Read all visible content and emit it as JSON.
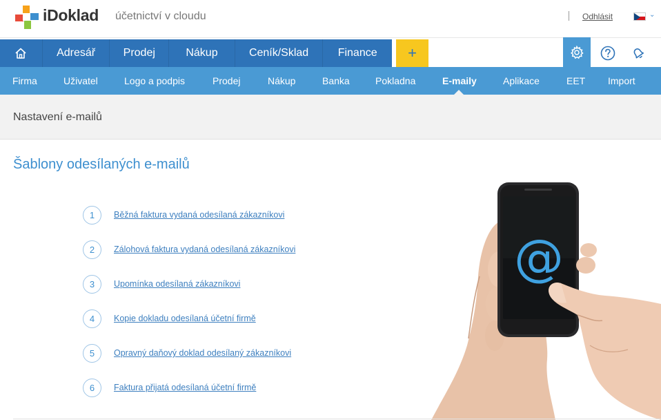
{
  "header": {
    "brand": "iDoklad",
    "tagline": "účetnictví v cloudu",
    "logout": "Odhlásit",
    "language_caret": "⌄"
  },
  "main_nav": {
    "items": [
      "Adresář",
      "Prodej",
      "Nákup",
      "Ceník/Sklad",
      "Finance"
    ],
    "plus": "+"
  },
  "sub_nav": {
    "items": [
      "Firma",
      "Uživatel",
      "Logo a podpis",
      "Prodej",
      "Nákup",
      "Banka",
      "Pokladna",
      "E-maily",
      "Aplikace",
      "EET",
      "Import"
    ],
    "active": "E-maily"
  },
  "page": {
    "title": "Nastavení e-mailů",
    "section_title": "Šablony odesílaných e-mailů"
  },
  "templates": [
    {
      "num": "1",
      "label": "Běžná faktura vydaná odesílaná zákazníkovi"
    },
    {
      "num": "2",
      "label": "Zálohová faktura vydaná odesílaná zákazníkovi"
    },
    {
      "num": "3",
      "label": "Upomínka odesílaná zákazníkovi"
    },
    {
      "num": "4",
      "label": "Kopie dokladu odesílaná účetní firmě"
    },
    {
      "num": "5",
      "label": "Opravný daňový doklad odesílaný zákazníkovi"
    },
    {
      "num": "6",
      "label": "Faktura přijatá odesílaná účetní firmě"
    }
  ],
  "illustration": {
    "screen_symbol": "@"
  },
  "colors": {
    "main_nav": "#2e73b8",
    "sub_nav": "#4a9ad4",
    "accent_yellow": "#f7c71f",
    "link": "#3d7fbf"
  }
}
